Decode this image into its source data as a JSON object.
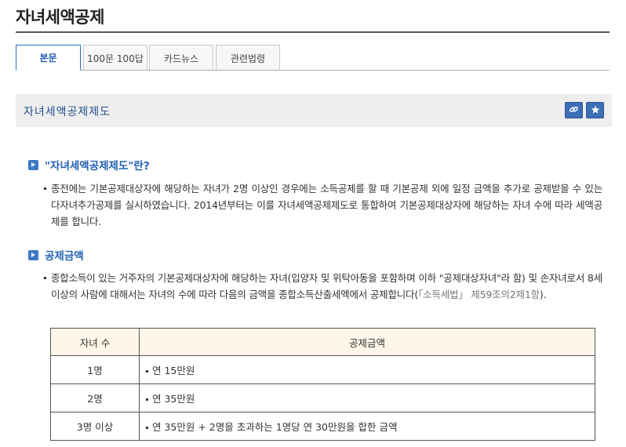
{
  "page": {
    "title": "자녀세액공제"
  },
  "tabs": [
    {
      "label": "본문",
      "active": true
    },
    {
      "label": "100문 100답",
      "active": false
    },
    {
      "label": "카드뉴스",
      "active": false
    },
    {
      "label": "관련법령",
      "active": false
    }
  ],
  "section": {
    "title": "자녀세액공제제도",
    "link_icon": "link-icon",
    "favorite_icon": "star-icon"
  },
  "definition": {
    "heading": "\"자녀세액공제제도\"란?",
    "text": "종전에는 기본공제대상자에 해당하는 자녀가 2명 이상인 경우에는 소득공제를 할 때 기본공제 외에 일정 금액을 추가로 공제받을 수 있는 다자녀추가공제를 실시하였습니다. 2014년부터는 이를 자녀세액공제제도로 통합하여 기본공제대상자에 해당하는 자녀 수에 따라 세액공제를 합니다."
  },
  "amount": {
    "heading": "공제금액",
    "text": "종합소득이 있는 거주자의 기본공제대상자에 해당하는 자녀(입양자 및 위탁아동을 포함하며 이하 \"공제대상자녀\"라 함) 및 손자녀로서 8세 이상의 사람에 대해서는 자녀의 수에 따라 다음의 금액을 종합소득산출세액에서 공제합니다(",
    "ref": "「소득세법」 제59조의2제1항",
    "tail": ")."
  },
  "table": {
    "headers": [
      "자녀 수",
      "공제금액"
    ],
    "rows": [
      {
        "count": "1명",
        "amount": "연 15만원"
      },
      {
        "count": "2명",
        "amount": "연 35만원"
      },
      {
        "count": "3명 이상",
        "amount": "연 35만원 + 2명을 초과하는 1명당 연 30만원을 합한 금액"
      }
    ]
  },
  "colors": {
    "accent": "#2462b4",
    "title_rule": "#555555",
    "section_bg": "#eeeeee",
    "table_header_bg": "#fdf5e8"
  }
}
